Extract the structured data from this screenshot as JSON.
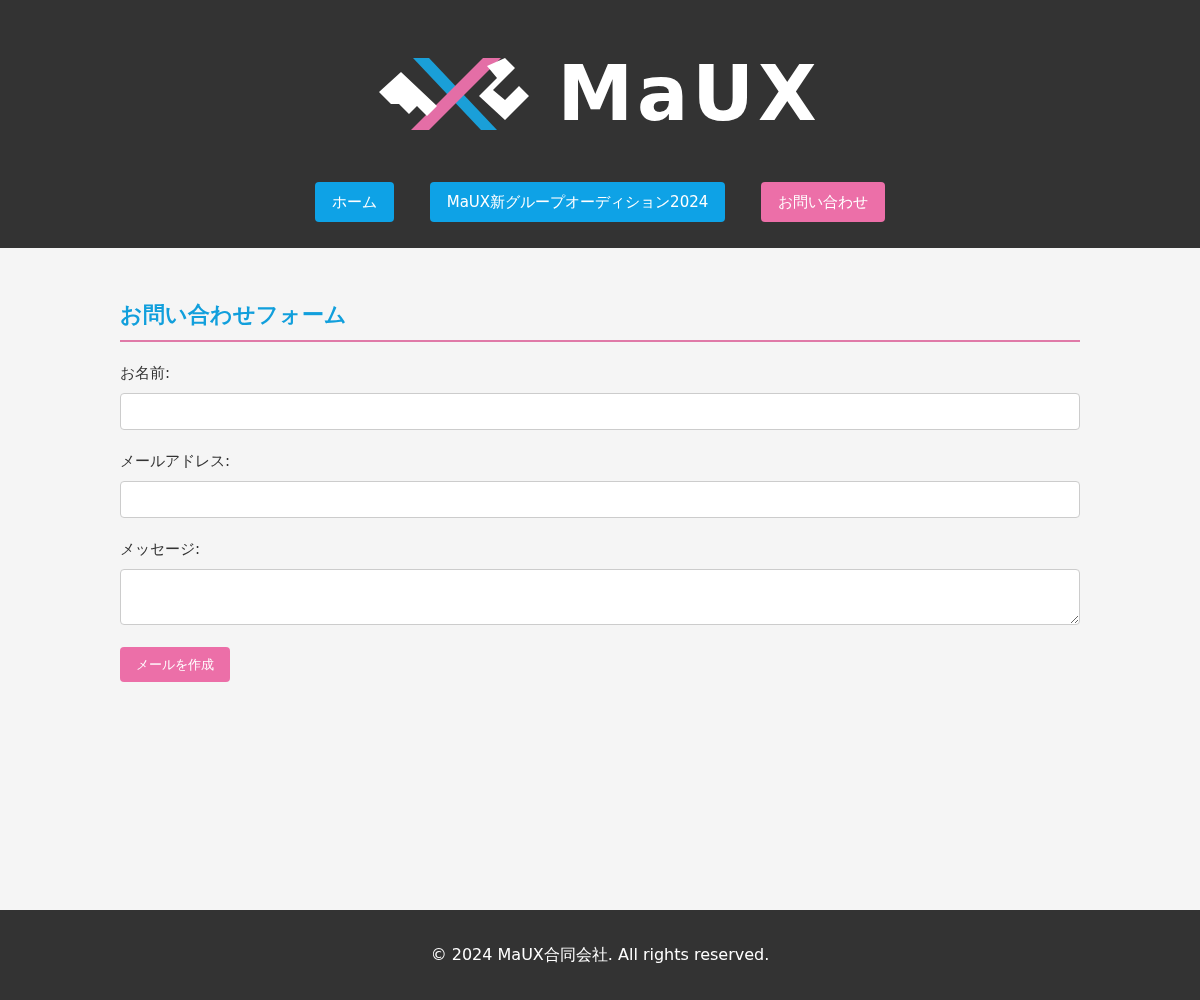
{
  "header": {
    "logo": {
      "text": "MaUX"
    },
    "nav": [
      {
        "label": "ホーム",
        "color": "#0ea2e6"
      },
      {
        "label": "MaUX新グループオーディション2024",
        "color": "#0ea2e6"
      },
      {
        "label": "お問い合わせ",
        "color": "#ec6fa8"
      }
    ]
  },
  "form": {
    "title": "お問い合わせフォーム",
    "fields": [
      {
        "kind": "input",
        "label": "お名前:"
      },
      {
        "kind": "input",
        "label": "メールアドレス:"
      },
      {
        "kind": "textarea",
        "label": "メッセージ:"
      }
    ],
    "submit": "メールを作成"
  },
  "footer": {
    "text": "© 2024 MaUX合同会社. All rights reserved."
  }
}
